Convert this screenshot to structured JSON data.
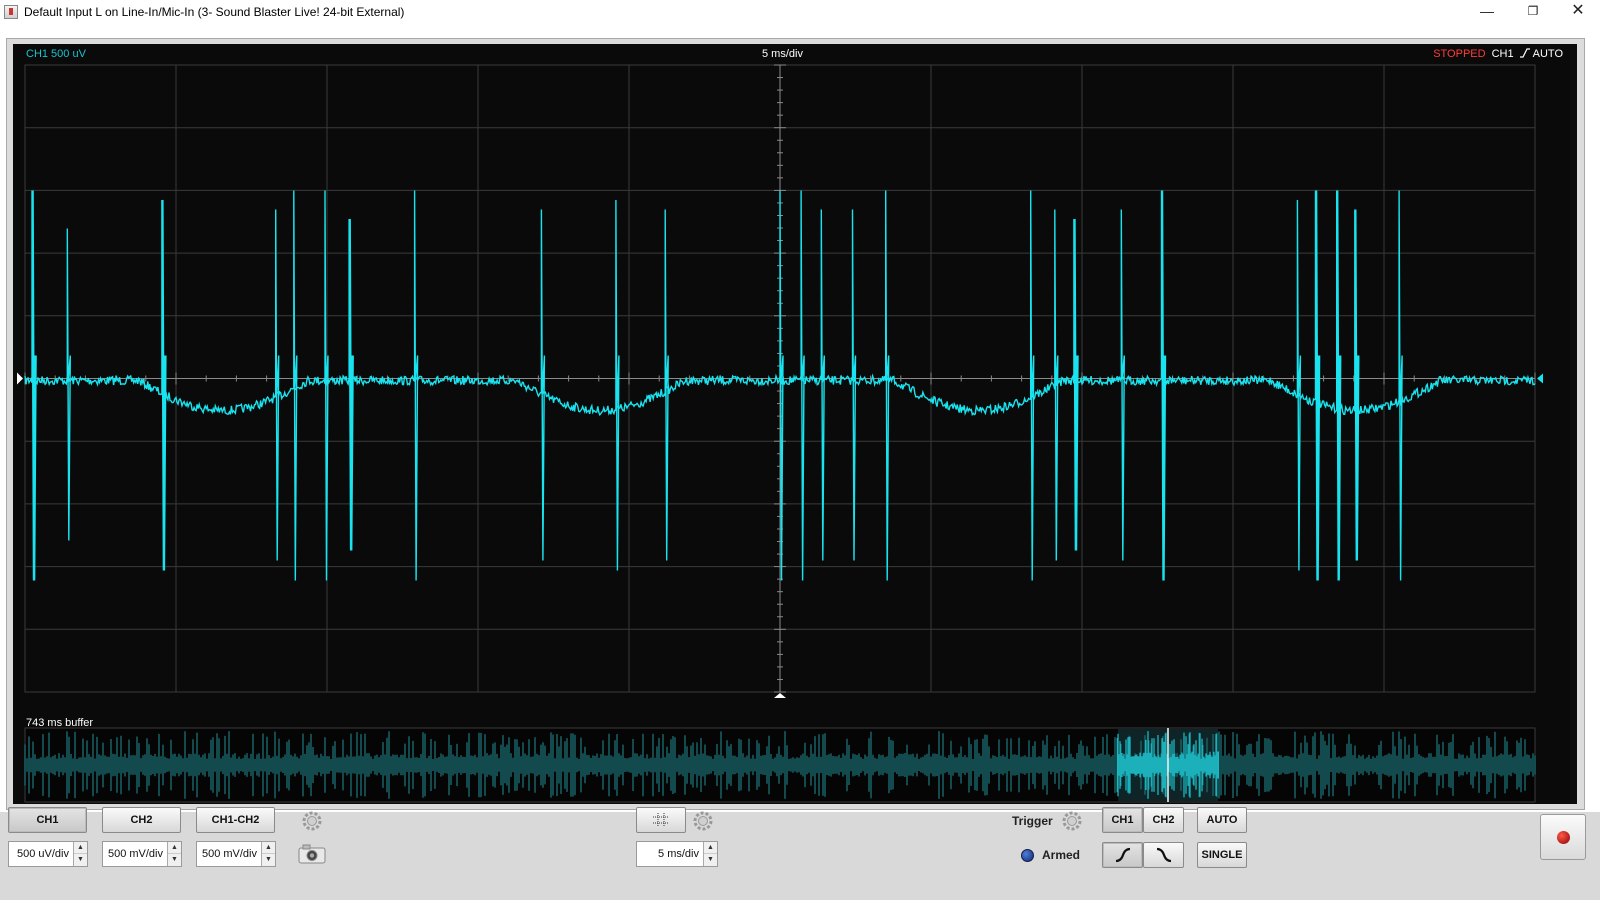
{
  "window": {
    "title": "Default Input L on Line-In/Mic-In (3- Sound Blaster Live! 24-bit External)",
    "minimize": "—",
    "maximize": "❐",
    "close": "✕"
  },
  "scope": {
    "ch1_scale": "CH1 500 uV",
    "time_div": "5 ms/div",
    "status": "STOPPED",
    "trigger_channel": "CH1",
    "trigger_mode": "AUTO",
    "buffer_label": "743 ms buffer",
    "colors": {
      "trace": "#19e3ee",
      "grid": "#3a3a3a",
      "background": "#0a0a0a",
      "stopped": "#ff3b3b"
    }
  },
  "controls": {
    "ch1_button": "CH1",
    "ch2_button": "CH2",
    "ch1_ch2_button": "CH1-CH2",
    "ch1_volts": "500 uV/div",
    "ch2_volts": "500 mV/div",
    "diff_volts": "500 mV/div",
    "timebase": "5 ms/div",
    "trigger_label": "Trigger",
    "trig_ch1": "CH1",
    "trig_ch2": "CH2",
    "auto_button": "AUTO",
    "single_button": "SINGLE",
    "armed_label": "Armed",
    "spin_up": "▲",
    "spin_down": "▼"
  }
}
